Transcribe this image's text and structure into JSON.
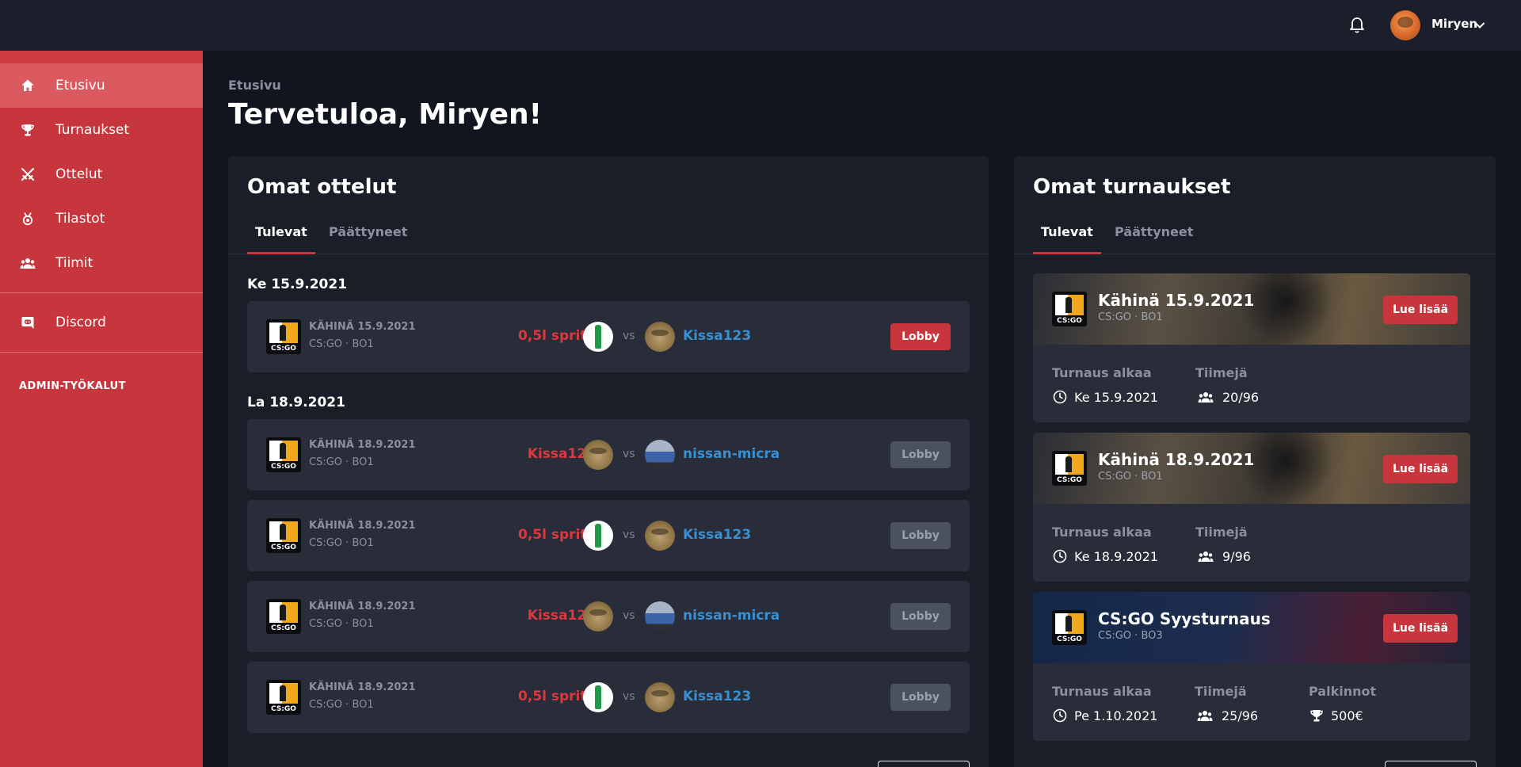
{
  "topbar": {
    "username": "Miryen"
  },
  "sidebar": {
    "items": [
      {
        "label": "Etusivu",
        "icon": "home-icon",
        "active": true
      },
      {
        "label": "Turnaukset",
        "icon": "trophy-icon"
      },
      {
        "label": "Ottelut",
        "icon": "swords-icon"
      },
      {
        "label": "Tilastot",
        "icon": "medal-icon"
      },
      {
        "label": "Tiimit",
        "icon": "team-icon"
      },
      {
        "label": "Discord",
        "icon": "discord-icon"
      }
    ],
    "admin_label": "ADMIN-TYÖKALUT"
  },
  "page": {
    "breadcrumb": "Etusivu",
    "title": "Tervetuloa, Miryen!"
  },
  "matches": {
    "title": "Omat ottelut",
    "tabs": [
      "Tulevat",
      "Päättyneet"
    ],
    "days": [
      "Ke 15.9.2021",
      "La 18.9.2021"
    ],
    "items": [
      {
        "name": "KÄHINÄ 15.9.2021",
        "game": "CS:GO",
        "format": "BO1",
        "team1": "0,5l sprite",
        "team1_avatar": "sprite-bottle",
        "vs": "vs",
        "team2": "Kissa123",
        "team2_avatar": "frog",
        "lobby": "Lobby",
        "lobby_active": true
      },
      {
        "name": "KÄHINÄ 18.9.2021",
        "game": "CS:GO",
        "format": "BO1",
        "team1": "Kissa123",
        "team1_avatar": "frog",
        "vs": "vs",
        "team2": "nissan-micra",
        "team2_avatar": "car",
        "lobby": "Lobby",
        "lobby_active": false
      },
      {
        "name": "KÄHINÄ 18.9.2021",
        "game": "CS:GO",
        "format": "BO1",
        "team1": "0,5l sprite",
        "team1_avatar": "sprite-bottle",
        "vs": "vs",
        "team2": "Kissa123",
        "team2_avatar": "frog",
        "lobby": "Lobby",
        "lobby_active": false
      },
      {
        "name": "KÄHINÄ 18.9.2021",
        "game": "CS:GO",
        "format": "BO1",
        "team1": "Kissa123",
        "team1_avatar": "frog",
        "vs": "vs",
        "team2": "nissan-micra",
        "team2_avatar": "car",
        "lobby": "Lobby",
        "lobby_active": false
      },
      {
        "name": "KÄHINÄ 18.9.2021",
        "game": "CS:GO",
        "format": "BO1",
        "team1": "0,5l sprite",
        "team1_avatar": "sprite-bottle",
        "vs": "vs",
        "team2": "Kissa123",
        "team2_avatar": "frog",
        "lobby": "Lobby",
        "lobby_active": false
      }
    ]
  },
  "tournaments": {
    "title": "Omat turnaukset",
    "tabs": [
      "Tulevat",
      "Päättyneet"
    ],
    "start_label": "Turnaus alkaa",
    "teams_label": "Tiimejä",
    "prizes_label": "Palkinnot",
    "more_label": "Lue lisää",
    "items": [
      {
        "name": "Kähinä 15.9.2021",
        "game": "CS:GO",
        "format": "BO1",
        "start": "Ke 15.9.2021",
        "teams": "20/96"
      },
      {
        "name": "Kähinä 18.9.2021",
        "game": "CS:GO",
        "format": "BO1",
        "start": "Ke 18.9.2021",
        "teams": "9/96"
      },
      {
        "name": "CS:GO Syysturnaus",
        "game": "CS:GO",
        "format": "BO3",
        "start": "Pe 1.10.2021",
        "teams": "25/96",
        "prize": "500€"
      }
    ]
  },
  "logo_text": "CS:GO",
  "separator": "·",
  "colors": {
    "accent": "#c7363c",
    "team_red": "#d9393f",
    "team_blue": "#3a8fd0",
    "background": "#111520",
    "panel": "#1a1e29",
    "card": "#282d39"
  }
}
